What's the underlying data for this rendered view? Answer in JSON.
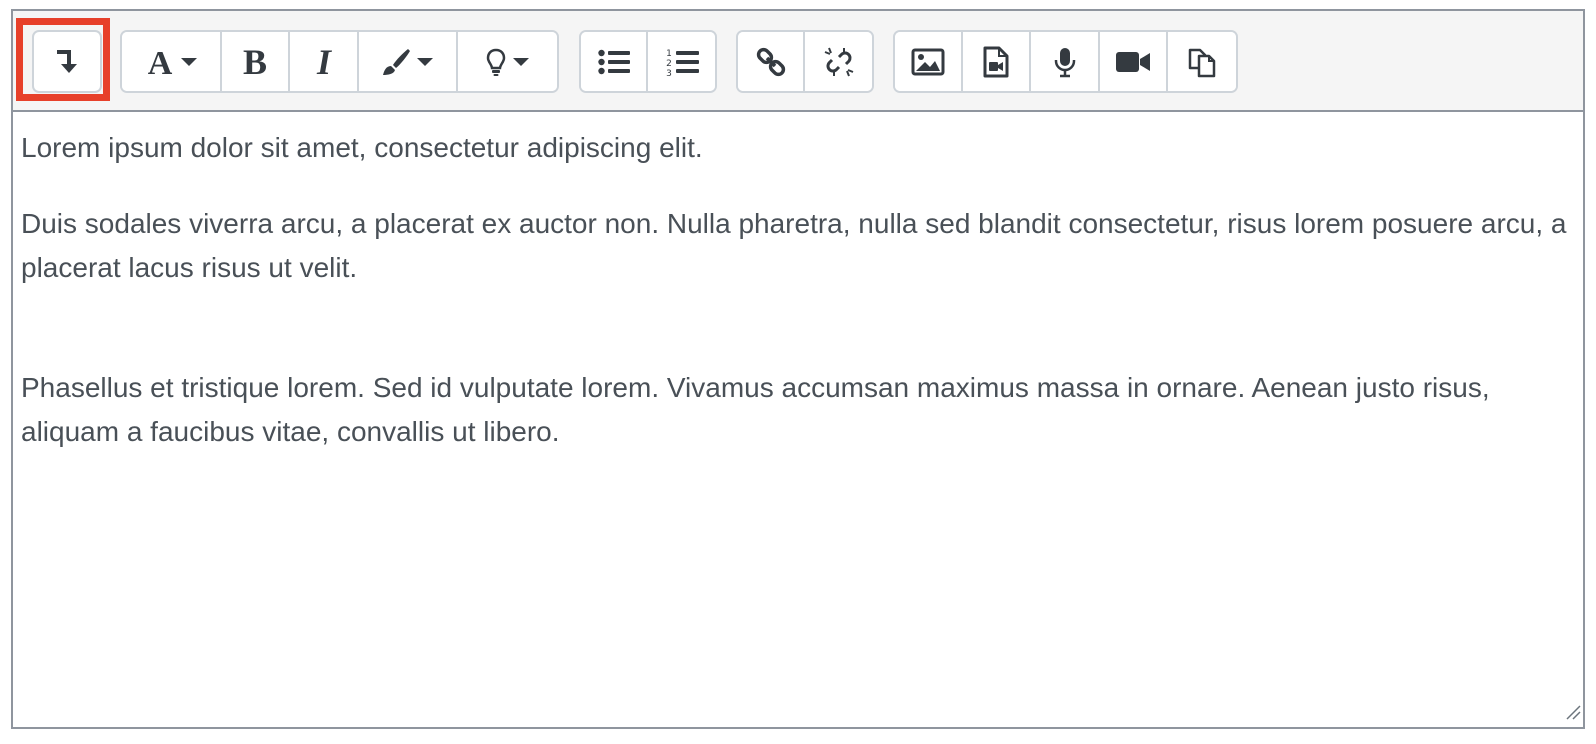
{
  "toolbar": {
    "toggle": {
      "icon": "show-more-buttons-icon",
      "highlighted": true,
      "highlight_color": "#e7402a"
    },
    "groups": [
      {
        "name": "style",
        "buttons": [
          "font-style-icon",
          "bold-icon",
          "italic-icon",
          "paint-brush-icon",
          "lightbulb-icon"
        ]
      },
      {
        "name": "lists",
        "buttons": [
          "unordered-list-icon",
          "ordered-list-icon"
        ]
      },
      {
        "name": "links",
        "buttons": [
          "link-icon",
          "unlink-icon"
        ]
      },
      {
        "name": "media",
        "buttons": [
          "image-icon",
          "media-file-icon",
          "microphone-icon",
          "video-camera-icon",
          "copy-files-icon"
        ]
      }
    ]
  },
  "content": {
    "paragraphs": [
      "Lorem ipsum dolor sit amet, consectetur adipiscing elit.",
      "Duis sodales viverra arcu, a placerat ex auctor non. Nulla pharetra, nulla sed blandit consectetur, risus lorem posuere arcu, a placerat lacus risus ut velit.",
      "Phasellus et tristique lorem. Sed id vulputate lorem. Vivamus accumsan maximus massa in ornare. Aenean justo risus, aliquam a faucibus vitae, convallis ut libero."
    ]
  },
  "colors": {
    "text": "#495057",
    "icon": "#343a40",
    "toolbar_bg": "#f5f5f5",
    "border": "#8f959e"
  }
}
